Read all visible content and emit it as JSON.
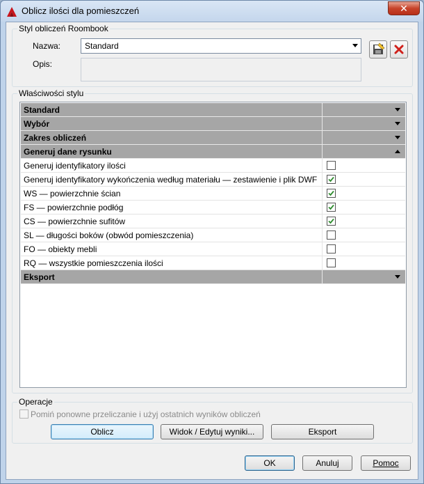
{
  "window": {
    "title": "Oblicz ilości dla pomieszczeń",
    "close_symbol": "✕",
    "icon": "autocad-a-icon"
  },
  "style_group": {
    "title": "Styl obliczeń Roombook",
    "name_label": "Nazwa:",
    "name_value": "Standard",
    "desc_label": "Opis:",
    "desc_value": "",
    "save_icon": "save-style-icon",
    "delete_icon": "delete-style-icon"
  },
  "properties_group": {
    "title": "Właściwości stylu",
    "categories": {
      "standard": {
        "label": "Standard",
        "expanded": false
      },
      "wybor": {
        "label": "Wybór",
        "expanded": false
      },
      "zakres": {
        "label": "Zakres obliczeń",
        "expanded": false
      },
      "generuj": {
        "label": "Generuj dane rysunku",
        "expanded": true
      },
      "eksport": {
        "label": "Eksport",
        "expanded": false
      }
    },
    "properties": [
      {
        "label": "Generuj identyfikatory ilości",
        "checked": false
      },
      {
        "label": "Generuj identyfikatory wykończenia według materiału — zestawienie i plik DWF",
        "checked": true
      },
      {
        "label": "WS — powierzchnie ścian",
        "checked": true
      },
      {
        "label": "FS — powierzchnie podłóg",
        "checked": true
      },
      {
        "label": "CS — powierzchnie sufitów",
        "checked": true
      },
      {
        "label": "SL — długości boków (obwód pomieszczenia)",
        "checked": false
      },
      {
        "label": "FO — obiekty mebli",
        "checked": false
      },
      {
        "label": "RQ — wszystkie pomieszczenia ilości",
        "checked": false
      }
    ]
  },
  "operations_group": {
    "title": "Operacje",
    "skip_label": "Pomiń ponowne przeliczanie i użyj ostatnich wyników obliczeń",
    "skip_checked": false,
    "calc_button": "Oblicz",
    "view_button": "Widok / Edytuj wyniki...",
    "export_button": "Eksport"
  },
  "footer": {
    "ok": "OK",
    "cancel": "Anuluj",
    "help": "Pomoc"
  },
  "colors": {
    "category_bg": "#a6a6a6",
    "check_green": "#2e8b2e",
    "delete_red": "#d0201a"
  }
}
